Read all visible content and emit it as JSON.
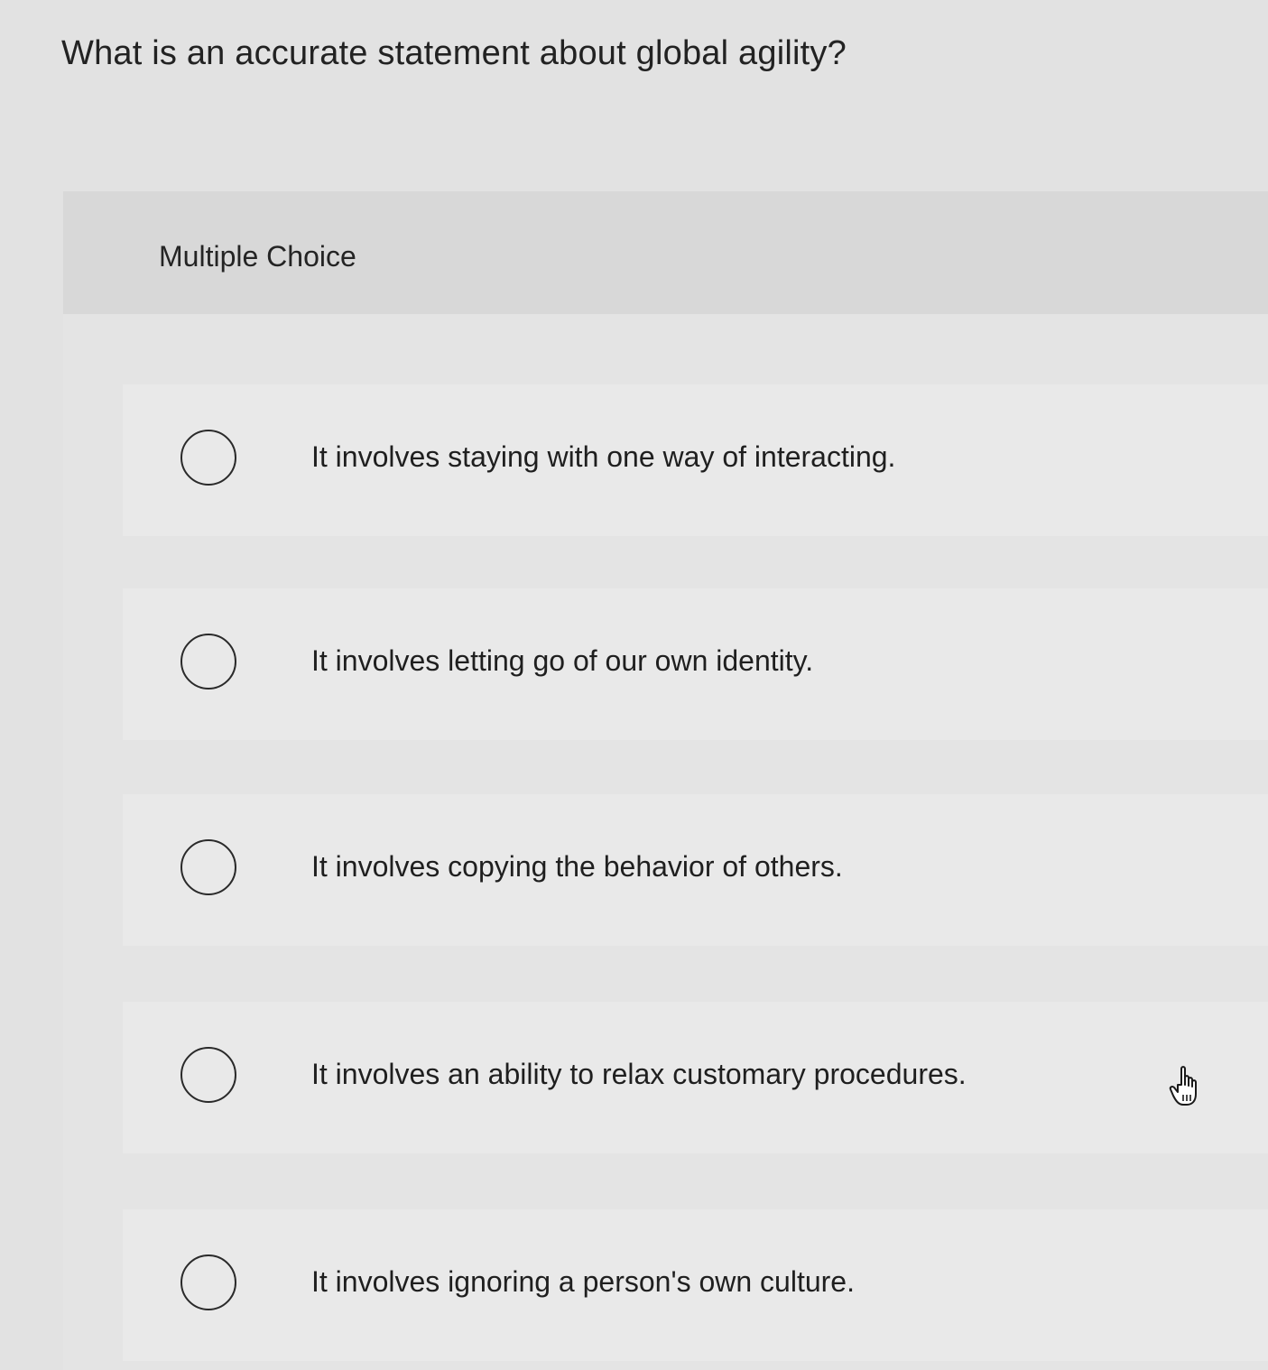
{
  "question": {
    "text": "What is an accurate statement about global agility?"
  },
  "panel": {
    "type_label": "Multiple Choice"
  },
  "choices": [
    {
      "label": "It involves staying with one way of interacting.",
      "selected": false
    },
    {
      "label": "It involves letting go of our own identity.",
      "selected": false
    },
    {
      "label": "It involves copying the behavior of others.",
      "selected": false
    },
    {
      "label": "It involves an ability to relax customary procedures.",
      "selected": false
    },
    {
      "label": "It involves ignoring a person's own culture.",
      "selected": false
    }
  ],
  "cursor": {
    "icon": "hand-pointer-icon"
  }
}
